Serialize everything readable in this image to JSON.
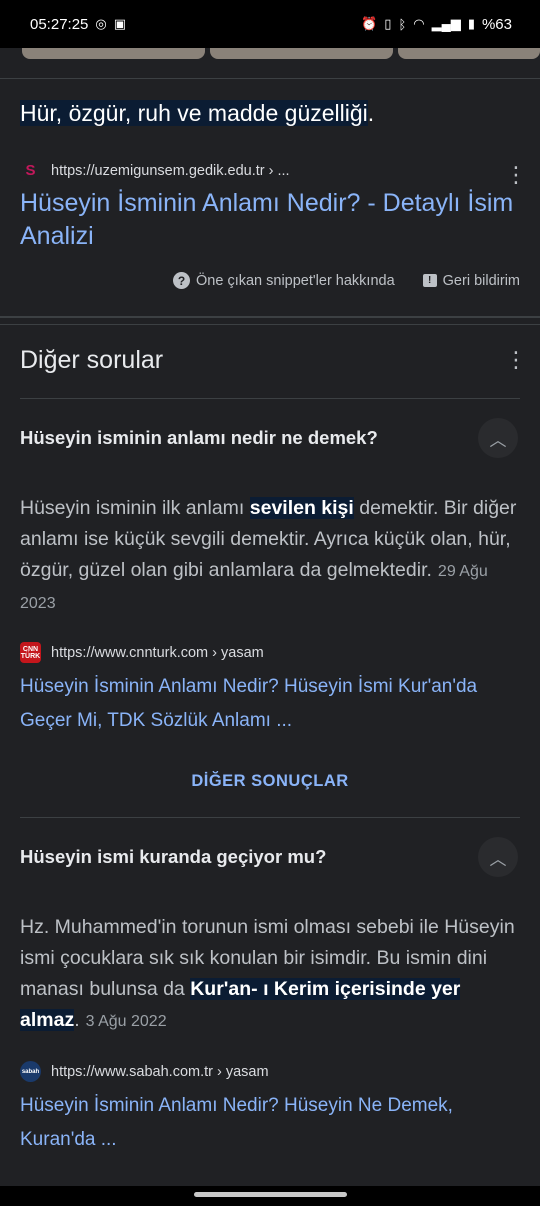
{
  "status_bar": {
    "time": "05:27:25",
    "battery": "%63",
    "left_icons": [
      "hotspot-icon",
      "image-icon"
    ],
    "right_icons": [
      "alarm-icon",
      "vibrate-icon",
      "bluetooth-icon",
      "wifi-icon",
      "signal-icon",
      "battery-icon"
    ]
  },
  "featured": {
    "highlight_text": "Hür, özgür, ruh ve madde güzelliği",
    "trailing": ".",
    "source_url": "https://uzemigunsem.gedik.edu.tr › ...",
    "link_line1": "Hüseyin İsminin Anlamı Nedir? - Detaylı İsim",
    "link_line2": "Analizi",
    "about_label": "Öne çıkan snippet'ler hakkında",
    "feedback_label": "Geri bildirim"
  },
  "other_questions": {
    "title": "Diğer sorular",
    "items": [
      {
        "question": "Hüseyin isminin anlamı nedir ne demek?",
        "answer_before": "Hüseyin isminin ilk anlamı ",
        "answer_highlight": "sevilen kişi",
        "answer_after": " demektir. Bir diğer anlamı ise küçük sevgili demektir. Ayrıca küçük olan, hür, özgür, güzel olan gibi anlamlara da gelmektedir.",
        "date": "29 Ağu 2023",
        "favicon": "CNN TÜRK",
        "source_url": "https://www.cnnturk.com › yasam",
        "link": "Hüseyin İsminin Anlamı Nedir? Hüseyin İsmi Kur'an'da Geçer Mi, TDK Sözlük Anlamı ..."
      },
      {
        "question": "Hüseyin ismi kuranda geçiyor mu?",
        "answer_before": "Hz. Muhammed'in torunun ismi olması sebebi ile Hüseyin ismi çocuklara sık sık konulan bir isimdir. Bu ismin dini manası bulunsa da ",
        "answer_highlight": "Kur'an- ı Kerim içerisinde yer almaz",
        "answer_after": ".",
        "date": "3 Ağu 2022",
        "favicon": "sabah",
        "source_url": "https://www.sabah.com.tr › yasam",
        "link": "Hüseyin İsminin Anlamı Nedir? Hüseyin Ne Demek, Kuran'da ..."
      }
    ],
    "more_results": "DİĞER SONUÇLAR"
  }
}
